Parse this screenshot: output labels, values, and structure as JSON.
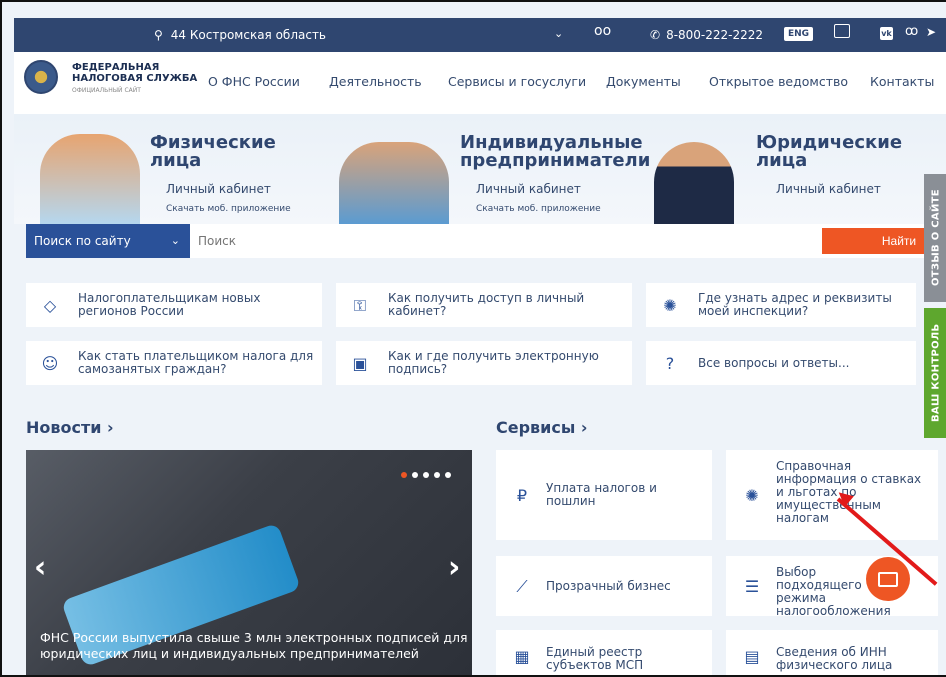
{
  "topbar": {
    "region": "44 Костромская область",
    "phone": "8-800-222-2222",
    "lang": "ENG",
    "vk": "vk"
  },
  "nav": {
    "brand_line1": "ФЕДЕРАЛЬНАЯ",
    "brand_line2": "НАЛОГОВАЯ СЛУЖБА",
    "brand_sub": "ОФИЦИАЛЬНЫЙ САЙТ",
    "items": [
      "О ФНС России",
      "Деятельность",
      "Сервисы и госуслуги",
      "Документы",
      "Открытое ведомство",
      "Контакты"
    ]
  },
  "hero": [
    {
      "title1": "Физические",
      "title2": "лица",
      "link1": "Личный кабинет",
      "link2": "Скачать моб. приложение"
    },
    {
      "title1": "Индивидуальные",
      "title2": "предприниматели",
      "link1": "Личный кабинет",
      "link2": "Скачать моб. приложение"
    },
    {
      "title1": "Юридические",
      "title2": "лица",
      "link1": "Личный кабинет"
    }
  ],
  "search": {
    "category": "Поиск по сайту",
    "placeholder": "Поиск",
    "button": "Найти"
  },
  "quick": [
    {
      "icon": "map-icon",
      "text": "Налогоплательщикам новых регионов России"
    },
    {
      "icon": "key-icon",
      "text": "Как получить доступ в личный кабинет?"
    },
    {
      "icon": "emblem-icon",
      "text": "Где узнать адрес и реквизиты моей инспекции?"
    },
    {
      "icon": "self-employed-icon",
      "text": "Как стать плательщиком налога для самозанятых граждан?"
    },
    {
      "icon": "signature-icon",
      "text": "Как и где получить электронную подпись?"
    },
    {
      "icon": "question-icon",
      "text": "Все вопросы и ответы..."
    }
  ],
  "sections": {
    "news": "Новости",
    "services": "Сервисы"
  },
  "news": {
    "caption": "ФНС России выпустила свыше 3 млн электронных подписей для юридических лиц и индивидуальных предпринимателей"
  },
  "services": [
    {
      "icon": "payment-icon",
      "text": "Уплата налогов и пошлин"
    },
    {
      "icon": "info-icon",
      "text": "Справочная информация о ставках и льготах по имущественным налогам"
    },
    {
      "icon": "business-icon",
      "text": "Прозрачный бизнес"
    },
    {
      "icon": "slider-icon",
      "text": "Выбор подходящего режима налогообложения"
    },
    {
      "icon": "registry-icon",
      "text": "Единый реестр субъектов МСП"
    },
    {
      "icon": "inn-icon",
      "text": "Сведения об ИНН физического лица"
    }
  ],
  "side": {
    "feedback": "ОТЗЫВ О САЙТЕ",
    "control": "ВАШ КОНТРОЛЬ"
  },
  "colors": {
    "header": "#2f4670",
    "accent": "#ee5624",
    "search": "#2a5199",
    "control": "#5ea72e",
    "feedback": "#8a8f96"
  }
}
